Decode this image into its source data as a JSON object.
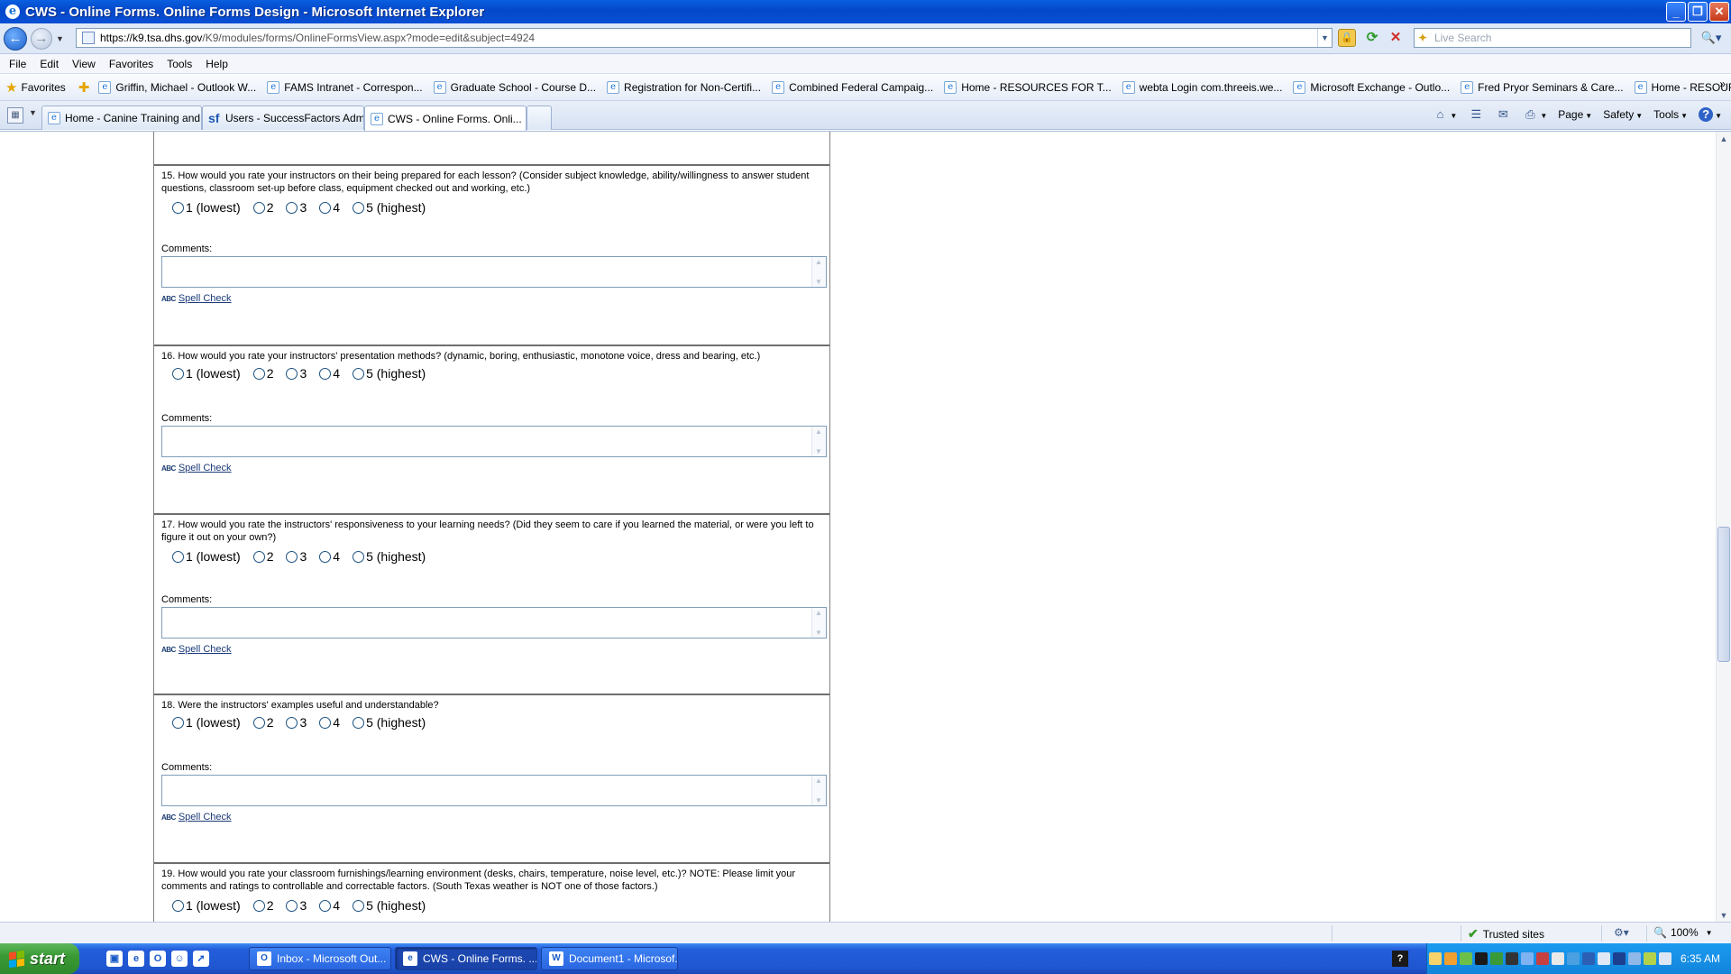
{
  "window": {
    "title": "CWS - Online Forms. Online Forms Design - Microsoft Internet Explorer",
    "ie_icon": "e"
  },
  "address": {
    "url_prefix": "https://",
    "url_host": "k9.tsa.dhs.gov",
    "url_rest": "/K9/modules/forms/OnlineFormsView.aspx?mode=edit&subject=4924",
    "search_placeholder": "Live Search"
  },
  "menu": [
    "File",
    "Edit",
    "View",
    "Favorites",
    "Tools",
    "Help"
  ],
  "favorites": {
    "label": "Favorites",
    "items": [
      "Griffin, Michael - Outlook W...",
      "FAMS Intranet - Correspon...",
      "Graduate School - Course D...",
      "Registration for Non-Certifi...",
      "Combined Federal Campaig...",
      "Home - RESOURCES FOR T...",
      "webta Login com.threeis.we...",
      "Microsoft Exchange - Outlo...",
      "Fred Pryor Seminars & Care...",
      "Home - RESOURCES FOR T..."
    ],
    "more": "»"
  },
  "tabs": [
    {
      "label": "Home - Canine Training and ..."
    },
    {
      "label": "Users - SuccessFactors Admi..."
    },
    {
      "label": "CWS - Online Forms. Onli..."
    }
  ],
  "commandbar": {
    "page": "Page",
    "safety": "Safety",
    "tools": "Tools",
    "help_glyph": "?"
  },
  "form": {
    "rating_options": [
      "1 (lowest)",
      "2",
      "3",
      "4",
      "5 (highest)"
    ],
    "comments_label": "Comments:",
    "spell_check": "Spell Check",
    "spell_icon": "ABC",
    "questions": [
      {
        "text": "15.  How would you rate your instructors on their being prepared for each lesson? (Consider subject knowledge, ability/willingness to answer student questions, classroom set-up before class, equipment checked out and working, etc.)"
      },
      {
        "text": "16.  How would you rate your instructors' presentation methods? (dynamic, boring, enthusiastic, monotone voice, dress and bearing, etc.)"
      },
      {
        "text": "17.  How would you rate the instructors' responsiveness to your learning needs? (Did they seem to care if you learned the material, or were you left to figure it out on your own?)"
      },
      {
        "text": "18.  Were the instructors' examples useful and understandable?"
      },
      {
        "text": "19.  How would you rate your classroom furnishings/learning environment (desks, chairs, temperature, noise level, etc.)? NOTE: Please limit your comments and ratings to controllable and correctable factors. (South Texas weather is NOT one of those factors.)"
      }
    ]
  },
  "status": {
    "zone": "Trusted sites",
    "zoom": "100%"
  },
  "taskbar": {
    "start": "start",
    "tasks": [
      {
        "label": "Inbox - Microsoft Out..."
      },
      {
        "label": "CWS - Online Forms. ..."
      },
      {
        "label": "Document1 - Microsof..."
      }
    ],
    "clock": "6:35 AM"
  }
}
